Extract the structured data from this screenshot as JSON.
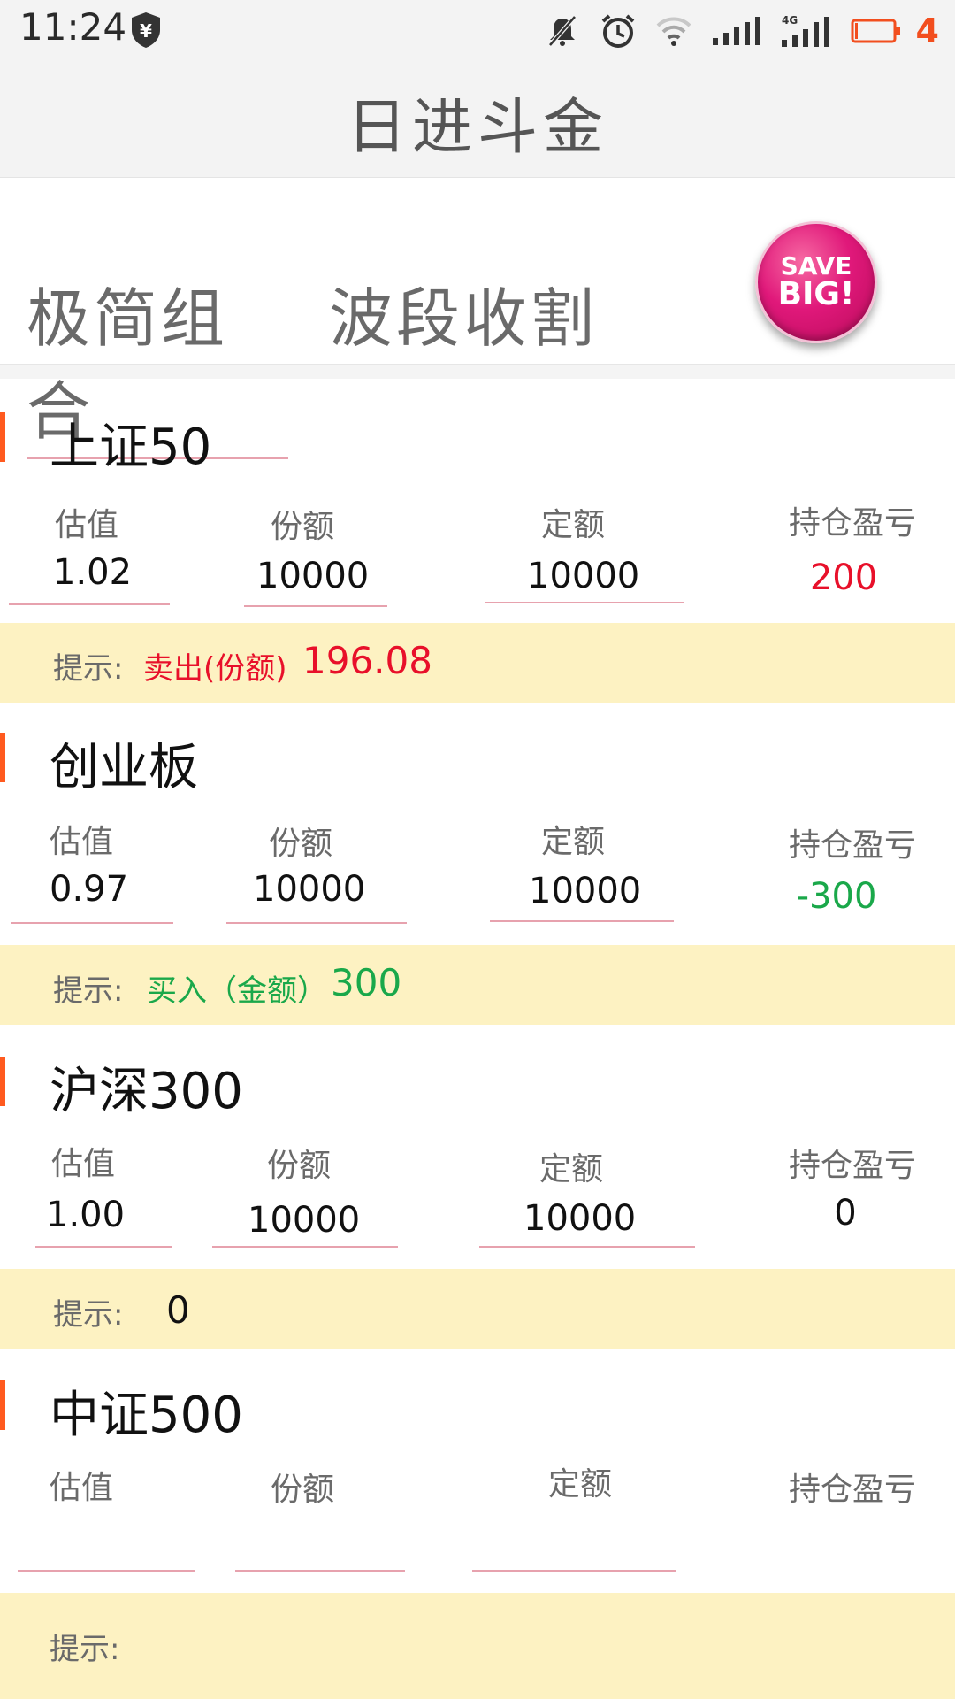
{
  "status_bar": {
    "time": "11:24",
    "battery_level": "4",
    "network": "4G",
    "icons": [
      "shield-yen-icon",
      "mute-icon",
      "alarm-icon",
      "wifi-icon",
      "signal-icon",
      "4g-signal-icon",
      "battery-icon"
    ]
  },
  "header": {
    "title": "日进斗金"
  },
  "tabs": [
    {
      "label": "极简组合",
      "active": true
    },
    {
      "label": "波段收割",
      "active": false
    }
  ],
  "promo": {
    "line1": "SAVE",
    "line2": "BIG!"
  },
  "columns": {
    "valuation": "估值",
    "shares": "份额",
    "fixed_amount": "定额",
    "pnl": "持仓盈亏"
  },
  "hint_label": "提示:",
  "colors": {
    "red": "#e8102a",
    "green": "#1aa84a",
    "accent": "#ff5a1f",
    "hint_bg": "#fdf2c2"
  },
  "funds": [
    {
      "name": "上证50",
      "valuation": "1.02",
      "shares": "10000",
      "fixed_amount": "10000",
      "pnl": "200",
      "pnl_color": "red",
      "hint_text": "卖出(份额)",
      "hint_value": "196.08",
      "hint_color": "red"
    },
    {
      "name": "创业板",
      "valuation": "0.97",
      "shares": "10000",
      "fixed_amount": "10000",
      "pnl": "-300",
      "pnl_color": "green",
      "hint_text": "买入（金额）",
      "hint_value": "300",
      "hint_color": "green"
    },
    {
      "name": "沪深300",
      "valuation": "1.00",
      "shares": "10000",
      "fixed_amount": "10000",
      "pnl": "0",
      "pnl_color": "black",
      "hint_text": "",
      "hint_value": "0",
      "hint_color": "black"
    },
    {
      "name": "中证500",
      "valuation": "",
      "shares": "",
      "fixed_amount": "",
      "pnl": "",
      "pnl_color": "black",
      "hint_text": "",
      "hint_value": "",
      "hint_color": "black"
    }
  ]
}
